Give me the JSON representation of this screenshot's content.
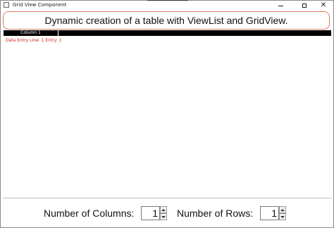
{
  "window": {
    "title": "Grid View Component",
    "close_glyph": "✕"
  },
  "header": {
    "text": "Dynamic creation of a table with ViewList and GridView."
  },
  "grid": {
    "columns": [
      "Column 1"
    ],
    "entry_text": "Data Entry Line: 1 Entry: 1"
  },
  "footer": {
    "columns_label": "Number of Columns:",
    "columns_value": "1",
    "rows_label": "Number of Rows:",
    "rows_value": "1"
  },
  "colors": {
    "header_border": "#e07a5f",
    "grid_header_bg": "#000000",
    "entry_text": "#cc2222"
  },
  "icons": {
    "app": "app-icon",
    "minimize": "minimize-icon",
    "maximize": "maximize-icon",
    "close": "close-icon",
    "spin_up": "chevron-up-icon",
    "spin_down": "chevron-down-icon"
  }
}
